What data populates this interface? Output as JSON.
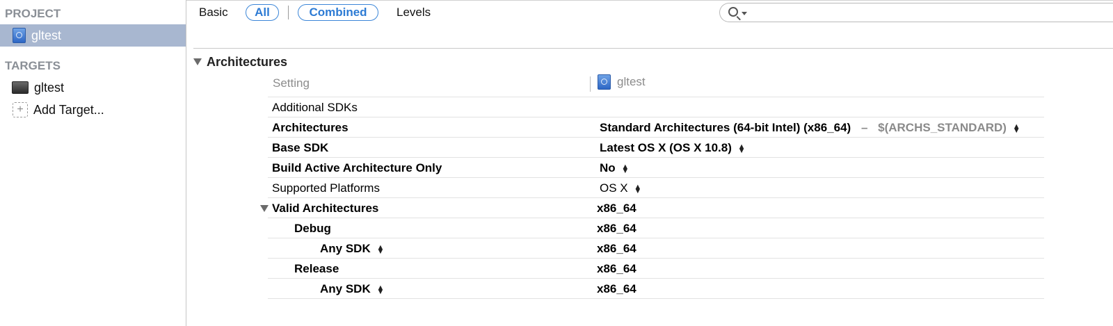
{
  "sidebar": {
    "project_header": "PROJECT",
    "project_item": "gltest",
    "targets_header": "TARGETS",
    "target_item": "gltest",
    "add_target": "Add Target..."
  },
  "filters": {
    "basic": "Basic",
    "all": "All",
    "combined": "Combined",
    "levels": "Levels",
    "selected": [
      "All",
      "Combined"
    ]
  },
  "search": {
    "value": "",
    "placeholder": ""
  },
  "group": {
    "title": "Architectures"
  },
  "table": {
    "col_setting": "Setting",
    "col_target": "gltest",
    "rows": {
      "additional_sdks": {
        "name": "Additional SDKs",
        "value": ""
      },
      "architectures": {
        "name": "Architectures",
        "value": "Standard Architectures (64-bit Intel) (x86_64)",
        "separator": "–",
        "macro": "$(ARCHS_STANDARD)"
      },
      "base_sdk": {
        "name": "Base SDK",
        "value": "Latest OS X (OS X 10.8)"
      },
      "build_active_arch": {
        "name": "Build Active Architecture Only",
        "value": "No"
      },
      "supported_platforms": {
        "name": "Supported Platforms",
        "value": "OS X"
      },
      "valid_architectures": {
        "name": "Valid Architectures",
        "value": "x86_64"
      },
      "debug": {
        "name": "Debug",
        "value": "x86_64"
      },
      "debug_any_sdk": {
        "name": "Any SDK",
        "value": "x86_64"
      },
      "release": {
        "name": "Release",
        "value": "x86_64"
      },
      "release_any_sdk": {
        "name": "Any SDK",
        "value": "x86_64"
      }
    }
  },
  "colors": {
    "selection": "#a8b7d0",
    "accent": "#2d7bd4",
    "section_header": "#8a8f96"
  }
}
